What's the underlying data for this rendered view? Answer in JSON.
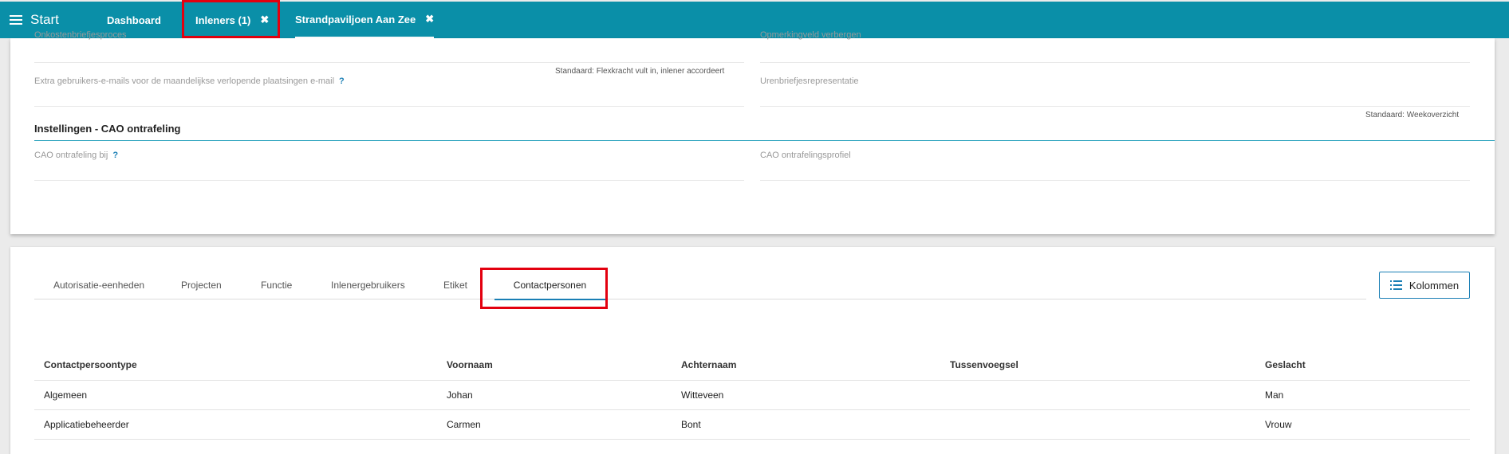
{
  "topbar": {
    "menu_label": "Start",
    "tabs": [
      {
        "label": "Dashboard"
      },
      {
        "label": "Inleners (1)",
        "close": "✖"
      },
      {
        "label": "Strandpaviljoen Aan Zee",
        "close": "✖"
      }
    ]
  },
  "settings": {
    "field_onkosten": "Onkostenbriefjesproces",
    "field_opmerking": "Opmerkingveld verbergen",
    "field_extra_emails": "Extra gebruikers-e-mails voor de maandelijkse verlopende plaatsingen e-mail",
    "help_mark": "?",
    "note_standaard_flex": "Standaard: Flexkracht vult in, inlener accordeert",
    "field_urenbriefjes": "Urenbriefjesrepresentatie",
    "note_standaard_week": "Standaard: Weekoverzicht",
    "section_title": "Instellingen - CAO ontrafeling",
    "field_cao_bij": "CAO ontrafeling bij",
    "field_cao_profiel": "CAO ontrafelingsprofiel"
  },
  "lower": {
    "tabs": [
      {
        "label": "Autorisatie-eenheden"
      },
      {
        "label": "Projecten"
      },
      {
        "label": "Functie"
      },
      {
        "label": "Inlenergebruikers"
      },
      {
        "label": "Etiket"
      },
      {
        "label": "Contactpersonen",
        "active": true
      }
    ],
    "kolommen_label": "Kolommen",
    "table": {
      "headers": [
        "Contactpersoontype",
        "Voornaam",
        "Achternaam",
        "Tussenvoegsel",
        "Geslacht"
      ],
      "rows": [
        [
          "Algemeen",
          "Johan",
          "Witteveen",
          "",
          "Man"
        ],
        [
          "Applicatiebeheerder",
          "Carmen",
          "Bont",
          "",
          "Vrouw"
        ]
      ]
    }
  },
  "colors": {
    "topbar": "#0a8fa8",
    "accent": "#1a7fb5",
    "highlight": "#e3000f"
  }
}
